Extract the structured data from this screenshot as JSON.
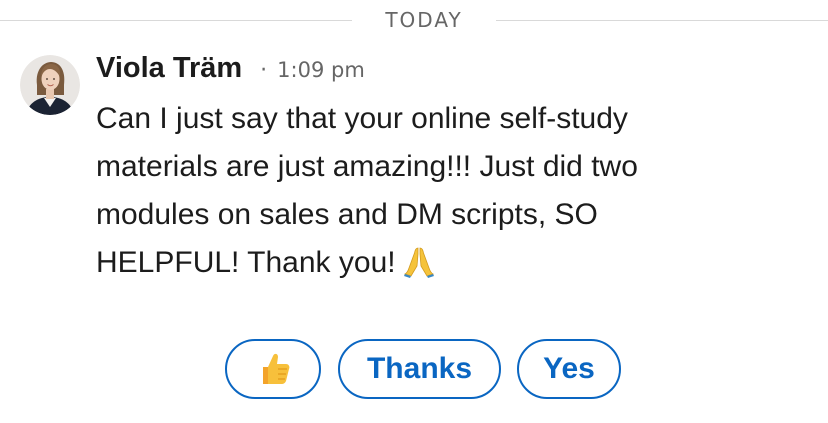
{
  "divider": {
    "label": "TODAY"
  },
  "message": {
    "sender_name": "Viola Träm",
    "separator": "·",
    "time": "1:09 pm",
    "body_lines": [
      "Can I just say that your online self-study",
      "materials are just amazing!!! Just did two",
      "modules on sales and DM scripts, SO",
      "HELPFUL! Thank you!"
    ],
    "trailing_emoji": "folded-hands-icon",
    "avatar": "avatar-photo"
  },
  "quick_replies": {
    "items": [
      {
        "kind": "emoji",
        "icon": "thumbs-up-icon"
      },
      {
        "kind": "text",
        "label": "Thanks"
      },
      {
        "kind": "text",
        "label": "Yes"
      }
    ]
  },
  "colors": {
    "accent": "#0a66c2",
    "divider_line": "#d9d9d9",
    "muted_text": "#666666",
    "body_text": "#1c1c1c"
  }
}
